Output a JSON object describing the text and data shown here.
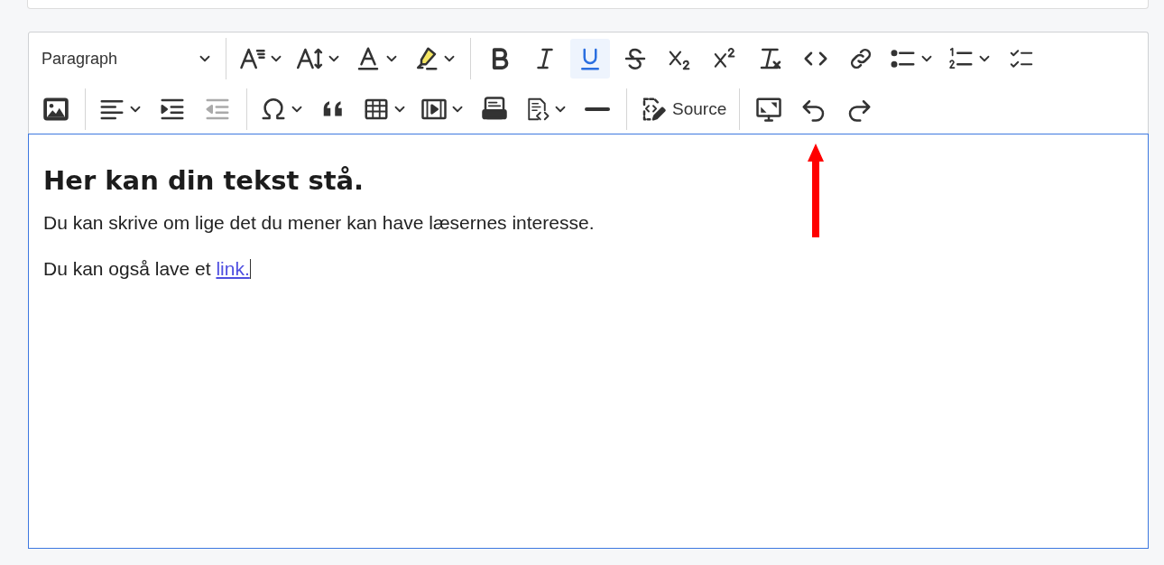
{
  "toolbar": {
    "rows": [
      [
        {
          "kind": "heading",
          "value": "Paragraph",
          "selected": false,
          "disabled": false
        },
        {
          "kind": "separator"
        },
        {
          "kind": "fontsize",
          "selected": false,
          "disabled": false
        },
        {
          "kind": "fontfamily",
          "selected": false,
          "disabled": false
        },
        {
          "kind": "fontcolor",
          "selected": false,
          "disabled": false
        },
        {
          "kind": "highlight",
          "selected": false,
          "disabled": false
        },
        {
          "kind": "separator"
        },
        {
          "kind": "bold",
          "selected": false,
          "disabled": false
        },
        {
          "kind": "italic",
          "selected": false,
          "disabled": false
        },
        {
          "kind": "underline",
          "selected": true,
          "disabled": false
        },
        {
          "kind": "strikethrough",
          "selected": false,
          "disabled": false
        },
        {
          "kind": "subscript",
          "selected": false,
          "disabled": false
        },
        {
          "kind": "superscript",
          "selected": false,
          "disabled": false
        },
        {
          "kind": "clearformat",
          "selected": false,
          "disabled": false
        },
        {
          "kind": "code",
          "selected": false,
          "disabled": false
        },
        {
          "kind": "link",
          "selected": false,
          "disabled": false
        },
        {
          "kind": "bullets",
          "selected": false,
          "disabled": false
        },
        {
          "kind": "numbering",
          "selected": false,
          "disabled": false
        },
        {
          "kind": "todo",
          "selected": false,
          "disabled": false
        }
      ],
      [
        {
          "kind": "image",
          "selected": false,
          "disabled": false
        },
        {
          "kind": "separator"
        },
        {
          "kind": "align",
          "selected": false,
          "disabled": false
        },
        {
          "kind": "indent",
          "selected": false,
          "disabled": false
        },
        {
          "kind": "outdent",
          "selected": false,
          "disabled": true
        },
        {
          "kind": "separator"
        },
        {
          "kind": "symbol",
          "selected": false,
          "disabled": false
        },
        {
          "kind": "quote",
          "selected": false,
          "disabled": false
        },
        {
          "kind": "table",
          "selected": false,
          "disabled": false
        },
        {
          "kind": "media",
          "selected": false,
          "disabled": false
        },
        {
          "kind": "html",
          "selected": false,
          "disabled": false
        },
        {
          "kind": "codeblock",
          "selected": false,
          "disabled": false
        },
        {
          "kind": "rule",
          "selected": false,
          "disabled": false
        },
        {
          "kind": "separator"
        },
        {
          "kind": "source",
          "label": "Source",
          "selected": false,
          "disabled": false
        },
        {
          "kind": "separator"
        },
        {
          "kind": "fullscreen",
          "selected": false,
          "disabled": false
        },
        {
          "kind": "undo",
          "selected": false,
          "disabled": false
        },
        {
          "kind": "redo",
          "selected": false,
          "disabled": false
        }
      ]
    ]
  },
  "content": {
    "heading": "Her kan din tekst stå.",
    "paragraphs": [
      {
        "text": "Du kan skrive om lige det du mener kan have læsernes interesse."
      },
      {
        "text": "Du kan også lave et ",
        "link": "link."
      }
    ]
  }
}
